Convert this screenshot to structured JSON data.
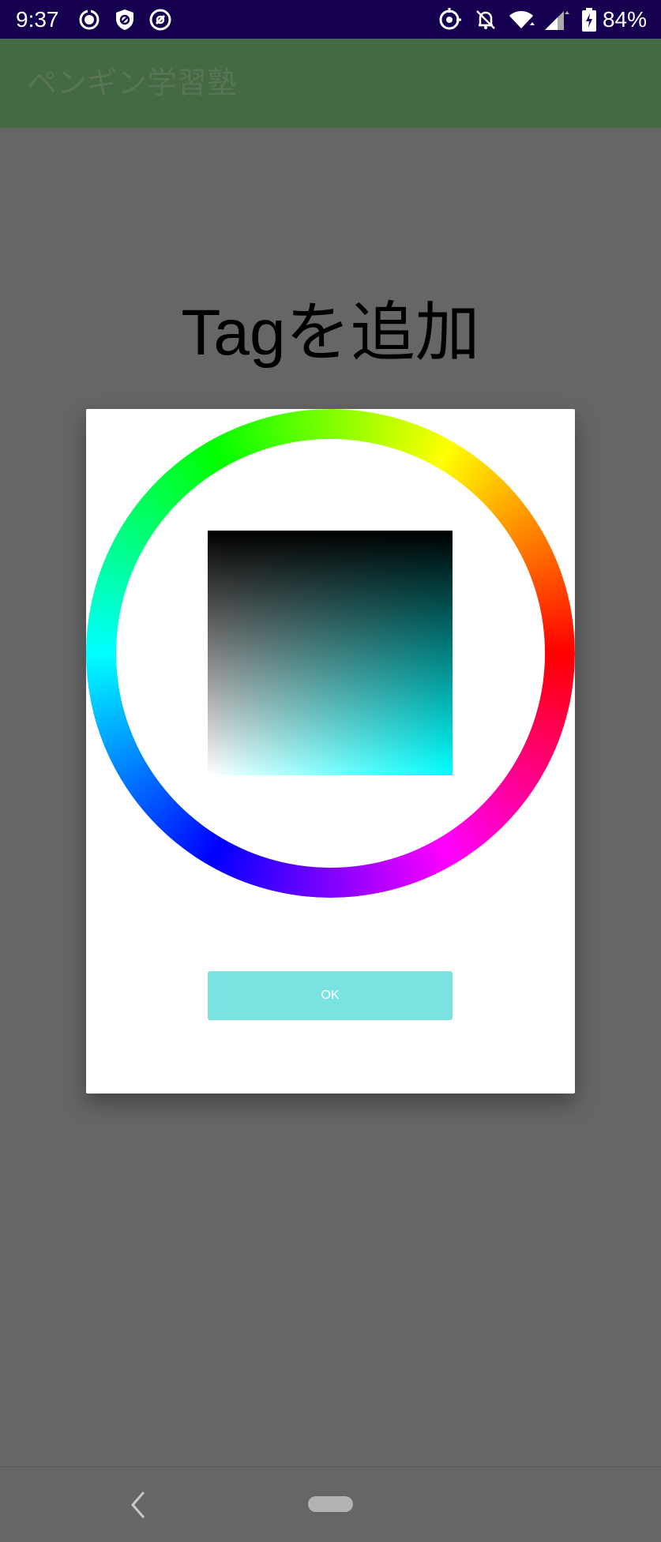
{
  "status_bar": {
    "time": "9:37",
    "battery_text": "84%",
    "left_icons": [
      "sync-icon",
      "shield-icon",
      "blocked-icon"
    ],
    "right_icons": [
      "location-icon",
      "notifications-off-icon",
      "wifi-icon",
      "signal-icon",
      "battery-charging-icon"
    ]
  },
  "app_bar": {
    "title": "ペンギン学習塾"
  },
  "page": {
    "heading": "Tagを追加"
  },
  "dialog": {
    "ok_label": "OK",
    "selected_hue_color": "#00ffff",
    "ok_button_color": "#7ae3df"
  },
  "nav_bar": {
    "icons": [
      "back-icon",
      "home-pill-icon"
    ]
  },
  "colors": {
    "status_bar": "#160050",
    "app_bar": "#436a40",
    "scrim": "#666666"
  }
}
